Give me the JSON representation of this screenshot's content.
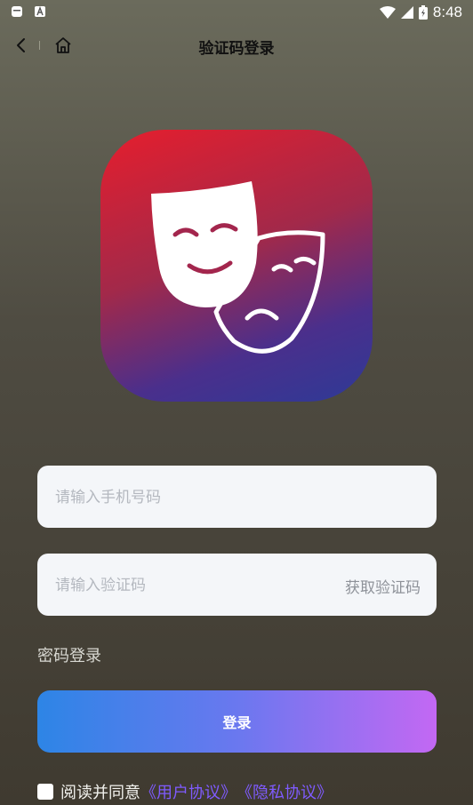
{
  "status_bar": {
    "time": "8:48"
  },
  "header": {
    "title": "验证码登录"
  },
  "form": {
    "phone_placeholder": "请输入手机号码",
    "code_placeholder": "请输入验证码",
    "get_code_label": "获取验证码",
    "password_login_label": "密码登录",
    "login_button_label": "登录"
  },
  "agreement": {
    "text": "阅读并同意",
    "user_agreement": "《用户协议》",
    "privacy_policy": "《隐私协议》"
  },
  "colors": {
    "accent_link": "#7f5bff",
    "button_gradient_start": "#2d85e6",
    "button_gradient_end": "#c368f3"
  }
}
